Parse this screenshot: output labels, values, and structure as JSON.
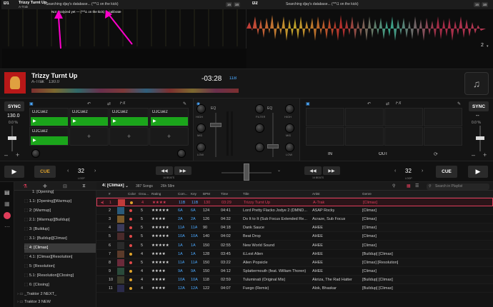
{
  "deck1": {
    "num": "D1",
    "title": "Trizzy Turnt Up",
    "artist": "A-Trak",
    "search": "Searching djay's database... (^^\\1 on the kick)",
    "overview_note": "Not analyzed yet — (^^\\1 on the kick) to calibrate",
    "btn1": "16",
    "btn2": "1B"
  },
  "deck2": {
    "num": "D2",
    "search": "Searching djay's database... (^^\\1 on the kick)",
    "btn1": "16",
    "btn2": "1B",
    "page": "2"
  },
  "now": {
    "title": "Trizzy Turnt Up",
    "artist": "A-Trak",
    "bpm": "130.0",
    "time": "-03:28",
    "key": "11B"
  },
  "left": {
    "sync": "SYNC",
    "bpm": "130.0",
    "pct": "0.0 %",
    "cue_pads": [
      "DJCue2",
      "DJCue2",
      "DJCue2",
      "DJCue2",
      "DJCue2"
    ],
    "fx": "FX",
    "cue": "CUE",
    "loop": "32",
    "loop_label": "LOOP",
    "beats": "16 BEATS",
    "hi": "HIGH",
    "mid": "MID",
    "low": "LOW",
    "filter": "FILTER",
    "eq": "EQ"
  },
  "right": {
    "sync": "SYNC",
    "bpm": "--",
    "pct": "0.0 %",
    "fx": "FX",
    "in": "IN",
    "out": "OUT",
    "cue": "CUE",
    "loop": "32",
    "loop_label": "LOOP",
    "beats": "16 BEATS",
    "hi": "HIGH",
    "mid": "MID",
    "low": "LOW",
    "filter": "FILTER",
    "eq": "EQ"
  },
  "library": {
    "playlist": "4: [Climax]",
    "songs": "387 Songs",
    "duration": "26h 58m",
    "search_placeholder": "Search in Playlist",
    "columns": [
      "#",
      "",
      "Color",
      "Grou...",
      "Rating",
      "Com...",
      "Key",
      "BPM",
      "Time",
      "Title",
      "Artist",
      "Genre"
    ],
    "tree": [
      "1: [Opening]",
      "1.1: [Opening][Warmup]",
      "2: [Warmup]",
      "2.1: [Warmup][Buildup]",
      "3: [Buildup]",
      "3.1: [Buildup][Climax]",
      "4: [Climax]",
      "4.1: [Climax][Resolution]",
      "5: [Resolution]",
      "5.1: [Resolution][Closing]",
      "6: [Closing]",
      "_Traktor 2 NEXT_",
      "Traktor 3 NEW"
    ],
    "rows": [
      {
        "n": "1",
        "grp": "4",
        "rating": "★★★★",
        "com": "11B",
        "key": "11B",
        "bpm": "130",
        "time": "03:29",
        "title": "Trizzy Turnt Up",
        "artist": "A-Trak",
        "genre": "[Climax]",
        "dot": "#e0a32a",
        "color": "#c23b3b"
      },
      {
        "n": "2",
        "grp": "5",
        "rating": "★★★★★",
        "com": "6A",
        "key": "6A",
        "bpm": "124",
        "time": "04:41",
        "title": "Lord Pretty Flacko Jodye 2 (DMND...",
        "artist": "ASAP Rocky",
        "genre": "[Climax]",
        "dot": "#e04848",
        "color": "#2a5a7a"
      },
      {
        "n": "3",
        "grp": "5",
        "rating": "★★★★",
        "com": "2A",
        "key": "2A",
        "bpm": "126",
        "time": "04:32",
        "title": "Do It to It (Sub Focus Extended Re...",
        "artist": "Acraze, Sub Focus",
        "genre": "[Climax]",
        "dot": "#e04848",
        "color": "#7a5a2a"
      },
      {
        "n": "4",
        "grp": "5",
        "rating": "★★★★★",
        "com": "11A",
        "key": "11A",
        "bpm": "90",
        "time": "04:18",
        "title": "Dank Sauce",
        "artist": "AHEE",
        "genre": "[Climax]",
        "dot": "#e04848",
        "color": "#3a3a5a"
      },
      {
        "n": "5",
        "grp": "5",
        "rating": "★★★★★",
        "com": "10A",
        "key": "10A",
        "bpm": "140",
        "time": "04:02",
        "title": "Beat Drop",
        "artist": "AHEE",
        "genre": "[Climax]",
        "dot": "#e04848",
        "color": "#4a2a2a"
      },
      {
        "n": "6",
        "grp": "5",
        "rating": "★★★★★",
        "com": "1A",
        "key": "1A",
        "bpm": "150",
        "time": "02:55",
        "title": "New World Sound",
        "artist": "AHEE",
        "genre": "[Climax]",
        "dot": "#e04848",
        "color": "#2a2a2a"
      },
      {
        "n": "7",
        "grp": "4",
        "rating": "★★★★",
        "com": "1A",
        "key": "1A",
        "bpm": "128",
        "time": "03:45",
        "title": "iLLest Alien",
        "artist": "AHEE",
        "genre": "[Buildup] [Climax]",
        "dot": "#e0a32a",
        "color": "#5a3a2a"
      },
      {
        "n": "8",
        "grp": "5",
        "rating": "★★★★★",
        "com": "11A",
        "key": "11A",
        "bpm": "150",
        "time": "03:22",
        "title": "Alien Popsicle",
        "artist": "AHEE",
        "genre": "[Climax] [Resolution]",
        "dot": "#e04848",
        "color": "#6a2a3a"
      },
      {
        "n": "9",
        "grp": "4",
        "rating": "★★★★",
        "com": "9A",
        "key": "9A",
        "bpm": "150",
        "time": "04:12",
        "title": "Splattermouth (feat. William Thoren)",
        "artist": "AHEE",
        "genre": "[Climax]",
        "dot": "#e0a32a",
        "color": "#2a4a3a"
      },
      {
        "n": "10",
        "grp": "4",
        "rating": "★★★★",
        "com": "10A",
        "key": "10A",
        "bpm": "118",
        "time": "02:59",
        "title": "Tuluminati (Original Mix)",
        "artist": "Akriza, The Rad Hatter",
        "genre": "[Buildup] [Climax]",
        "dot": "#e0a32a",
        "color": "#3a3a2a"
      },
      {
        "n": "11",
        "grp": "4",
        "rating": "★★★★",
        "com": "12A",
        "key": "12A",
        "bpm": "122",
        "time": "04:07",
        "title": "Fuego (Remix)",
        "artist": "Alok, Bhaskar",
        "genre": "[Buildup] [Climax]",
        "dot": "#e0a32a",
        "color": "#2a2a4a"
      }
    ]
  },
  "colors": {
    "accent": "#e03d5a",
    "green": "#1ba51b",
    "key_blue": "#4aa8ff",
    "arrow": "#ff00cc"
  },
  "icons": [
    "search-icon",
    "gear-icon",
    "music-note-icon",
    "play-icon",
    "filter-icon",
    "grid-icon",
    "list-icon"
  ]
}
